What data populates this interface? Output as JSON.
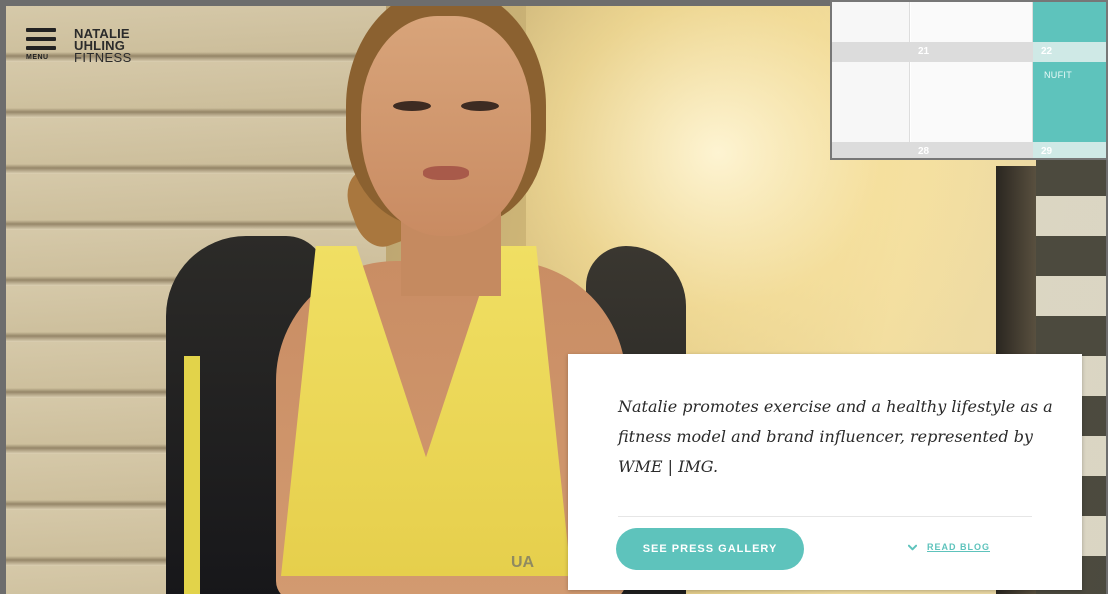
{
  "header": {
    "menu_label": "MENU",
    "logo_line1": "NATALIE UHLING",
    "logo_line2": "FITNESS"
  },
  "calendar": {
    "days": [
      "21",
      "22",
      "28",
      "29"
    ],
    "event": "NUFIT"
  },
  "hero": {
    "brand_mark": "UA"
  },
  "card": {
    "tagline": "Natalie promotes exercise and a healthy lifestyle as a fitness model and brand influencer, represented by WME | IMG.",
    "press_button": "SEE PRESS GALLERY",
    "read_blog": "READ BLOG"
  },
  "colors": {
    "accent": "#5ec3bc",
    "text_dark": "#2a2a2a"
  },
  "icons": {
    "menu": "hamburger-menu-icon",
    "read_blog": "chevron-down-icon"
  }
}
